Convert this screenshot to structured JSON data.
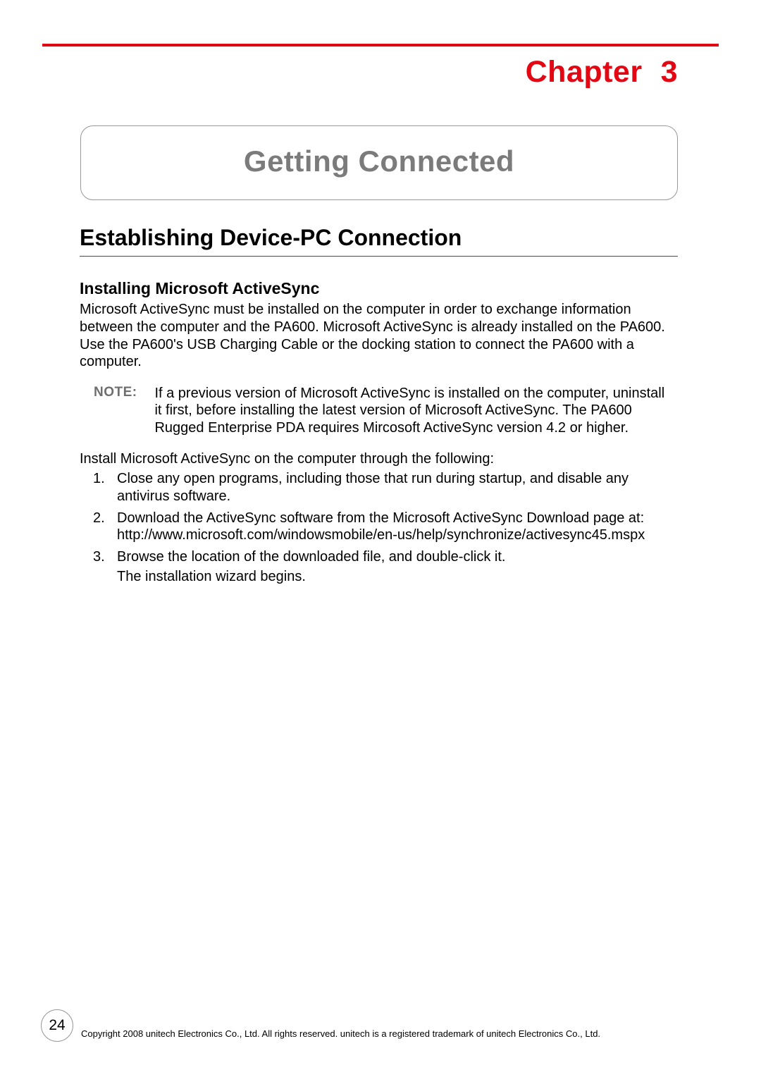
{
  "chapter": {
    "label": "Chapter",
    "number": "3"
  },
  "title_box": "Getting Connected",
  "section_h1": "Establishing Device-PC Connection",
  "section_h2": "Installing Microsoft ActiveSync",
  "body_para": "Microsoft ActiveSync must be installed on the computer in order to exchange information between the computer and the PA600. Microsoft ActiveSync is already installed on the PA600. Use the PA600's USB Charging Cable or the docking station to connect the PA600 with a computer.",
  "note": {
    "label": "NOTE:",
    "text": "If a previous version of Microsoft ActiveSync is installed on the computer, uninstall it first, before installing the latest version of Microsoft ActiveSync. The PA600 Rugged Enterprise PDA requires Mircosoft ActiveSync version 4.2 or higher."
  },
  "install_intro": "Install Microsoft ActiveSync on the computer through the following:",
  "steps": [
    {
      "n": "1.",
      "text": "Close any open programs, including those that run during startup, and disable any antivirus software."
    },
    {
      "n": "2.",
      "text": "Download the ActiveSync software from the Microsoft ActiveSync Download page at: http://www.microsoft.com/windowsmobile/en-us/help/synchronize/activesync45.mspx"
    },
    {
      "n": "3.",
      "text": "Browse the location of the downloaded file, and double-click it.",
      "sub": "The installation wizard begins."
    }
  ],
  "page_number": "24",
  "copyright": "Copyright 2008 unitech Electronics Co., Ltd. All rights reserved. unitech is a registered trademark of unitech Electronics Co., Ltd."
}
